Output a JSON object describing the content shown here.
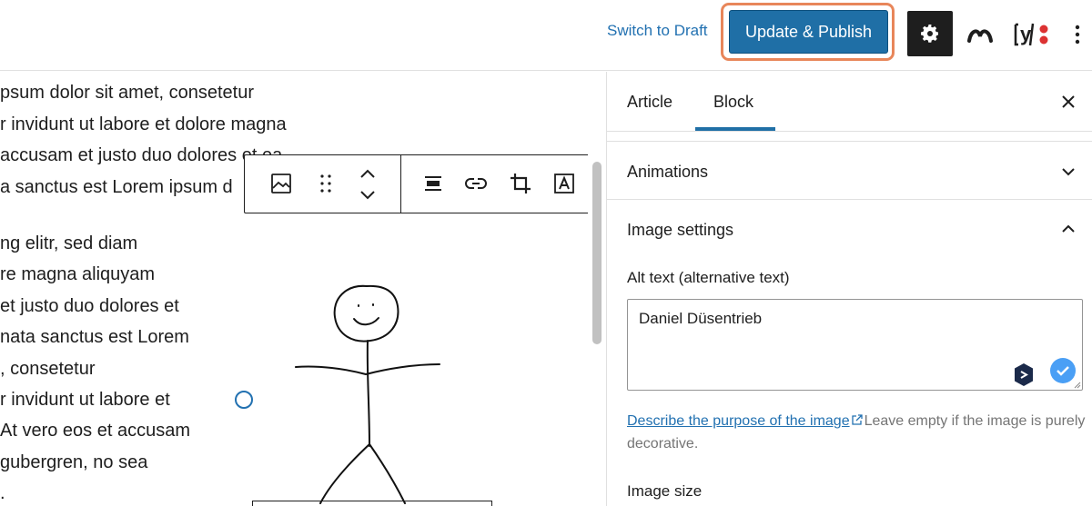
{
  "header": {
    "switch_draft_label": "Switch to Draft",
    "publish_label": "Update & Publish",
    "settings_icon": "gear-icon",
    "plugin_icon": "wave-logo-icon",
    "yoast_icon": "yoast-icon",
    "yoast_letter": "y",
    "more_icon": "vertical-ellipsis-icon"
  },
  "editor": {
    "lines": [
      "psum dolor sit amet, consetetur",
      "r invidunt ut labore et dolore magna",
      "accusam et justo duo dolores et ea",
      "a sanctus est Lorem ipsum d",
      "ng elitr, sed diam",
      "re magna aliquyam",
      "et justo duo dolores et",
      "nata sanctus est Lorem",
      ", consetetur",
      "r invidunt ut labore et",
      "At vero eos et accusam",
      "gubergren, no sea",
      "."
    ],
    "toolbar_icons": [
      "image-icon",
      "drag-handle-icon",
      "move-up-down-icon",
      "align-icon",
      "link-icon",
      "crop-icon",
      "text-over-image-icon"
    ]
  },
  "sidebar": {
    "tabs": [
      {
        "label": "Article",
        "active": false
      },
      {
        "label": "Block",
        "active": true
      }
    ],
    "close_icon": "close-icon",
    "panels": {
      "animations": "Animations",
      "image_settings": "Image settings"
    },
    "alt_text": {
      "label": "Alt text (alternative text)",
      "value": "Daniel Düsentrieb"
    },
    "help": {
      "link": "Describe the purpose of the image",
      "rest": "Leave empty if the image is purely decorative."
    },
    "image_size_label": "Image size"
  },
  "colors": {
    "accent": "#1f6fa6",
    "highlight_ring": "#e8865a",
    "link": "#2271b1"
  }
}
